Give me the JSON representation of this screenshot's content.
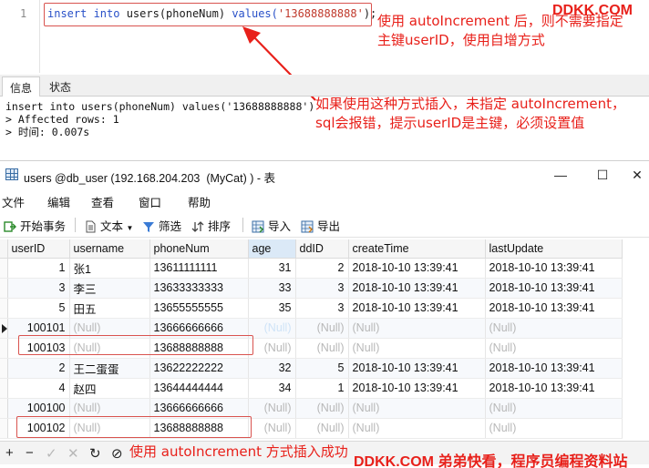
{
  "editor": {
    "line_number": "1",
    "sql_kw1": "insert into",
    "sql_mid": " users(phoneNum) ",
    "sql_kw2": "values(",
    "sql_str": "'13688888888'",
    "sql_end": ");"
  },
  "annotations": {
    "note1": "使用 autoIncrement 后，则不需要指定\n主键userID，使用自增方式",
    "note2": "如果使用这种方式插入，未指定 autoIncrement，\nsql会报错，提示userID是主键，必须设置值",
    "note3": "使用 autoIncrement 方式插入成功",
    "watermark_top": "DDKK.COM",
    "watermark_bottom": "DDKK.COM 弟弟快看，程序员编程资料站"
  },
  "message_panel": {
    "tabs": [
      "信息",
      "状态"
    ],
    "lines": [
      "insert into users(phoneNum) values('13688888888')",
      "> Affected rows: 1",
      "> 时间: 0.007s"
    ]
  },
  "window": {
    "title": "users @db_user (192.168.204.203  (MyCat) ) - 表",
    "minimize": "—",
    "maximize": "☐",
    "close": "✕"
  },
  "menu": [
    "文件",
    "编辑",
    "查看",
    "窗口",
    "帮助"
  ],
  "toolbar": {
    "begin_tx": "开始事务",
    "text": "文本",
    "filter": "筛选",
    "sort": "排序",
    "import": "导入",
    "export": "导出"
  },
  "table": {
    "columns": [
      "userID",
      "username",
      "phoneNum",
      "age",
      "ddID",
      "createTime",
      "lastUpdate"
    ],
    "rows": [
      [
        "1",
        "张1",
        "13611111111",
        "31",
        "2",
        "2018-10-10 13:39:41",
        "2018-10-10 13:39:41"
      ],
      [
        "3",
        "李三",
        "13633333333",
        "33",
        "3",
        "2018-10-10 13:39:41",
        "2018-10-10 13:39:41"
      ],
      [
        "5",
        "田五",
        "13655555555",
        "35",
        "3",
        "2018-10-10 13:39:41",
        "2018-10-10 13:39:41"
      ],
      [
        "100101",
        "(Null)",
        "13666666666",
        "(Null)",
        "(Null)",
        "(Null)",
        "(Null)"
      ],
      [
        "100103",
        "(Null)",
        "13688888888",
        "(Null)",
        "(Null)",
        "(Null)",
        "(Null)"
      ],
      [
        "2",
        "王二蛋蛋",
        "13622222222",
        "32",
        "5",
        "2018-10-10 13:39:41",
        "2018-10-10 13:39:41"
      ],
      [
        "4",
        "赵四",
        "13644444444",
        "34",
        "1",
        "2018-10-10 13:39:41",
        "2018-10-10 13:39:41"
      ],
      [
        "100100",
        "(Null)",
        "13666666666",
        "(Null)",
        "(Null)",
        "(Null)",
        "(Null)"
      ],
      [
        "100102",
        "(Null)",
        "13688888888",
        "(Null)",
        "(Null)",
        "(Null)",
        "(Null)"
      ]
    ]
  },
  "bottombar": {
    "add": "+",
    "remove": "−",
    "apply": "✓",
    "discard": "✕",
    "refresh": "↻",
    "stop": "⊘"
  },
  "colors": {
    "annotation_red": "#e8201a",
    "selection_blue": "#2d7fd0"
  }
}
